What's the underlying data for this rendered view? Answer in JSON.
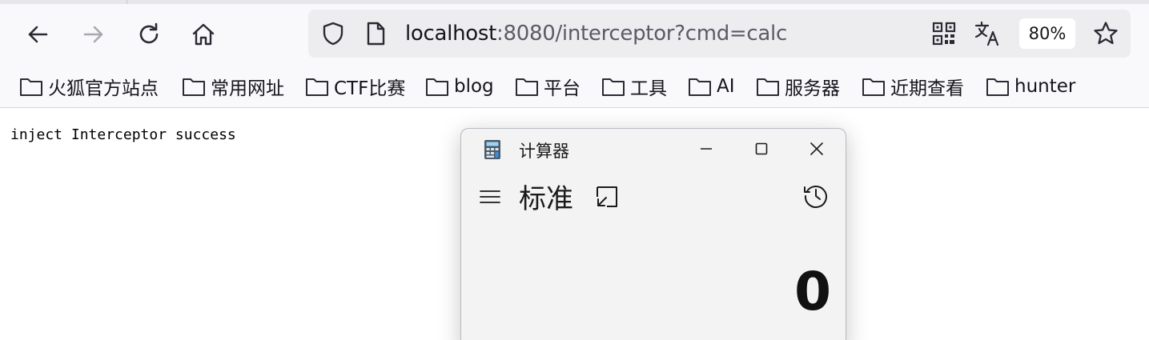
{
  "browser": {
    "nav": {
      "back_icon": "arrow-left-icon",
      "forward_icon": "arrow-right-icon",
      "reload_icon": "reload-icon",
      "home_icon": "home-icon"
    },
    "url": {
      "host": "localhost",
      "rest": ":8080/interceptor?cmd=calc"
    },
    "zoom": "80%",
    "bookmarks": [
      {
        "label": "火狐官方站点"
      },
      {
        "label": "常用网址"
      },
      {
        "label": "CTF比赛"
      },
      {
        "label": "blog"
      },
      {
        "label": "平台"
      },
      {
        "label": "工具"
      },
      {
        "label": "AI"
      },
      {
        "label": "服务器"
      },
      {
        "label": "近期查看"
      },
      {
        "label": "hunter"
      }
    ]
  },
  "page": {
    "body_text": "inject Interceptor success"
  },
  "calculator": {
    "window_title": "计算器",
    "mode": "标准",
    "display": "0"
  },
  "colors": {
    "toolbar_bg": "#f9f9fb",
    "urlbar_bg": "#ededf0",
    "calc_bg": "#f3f3f3"
  }
}
